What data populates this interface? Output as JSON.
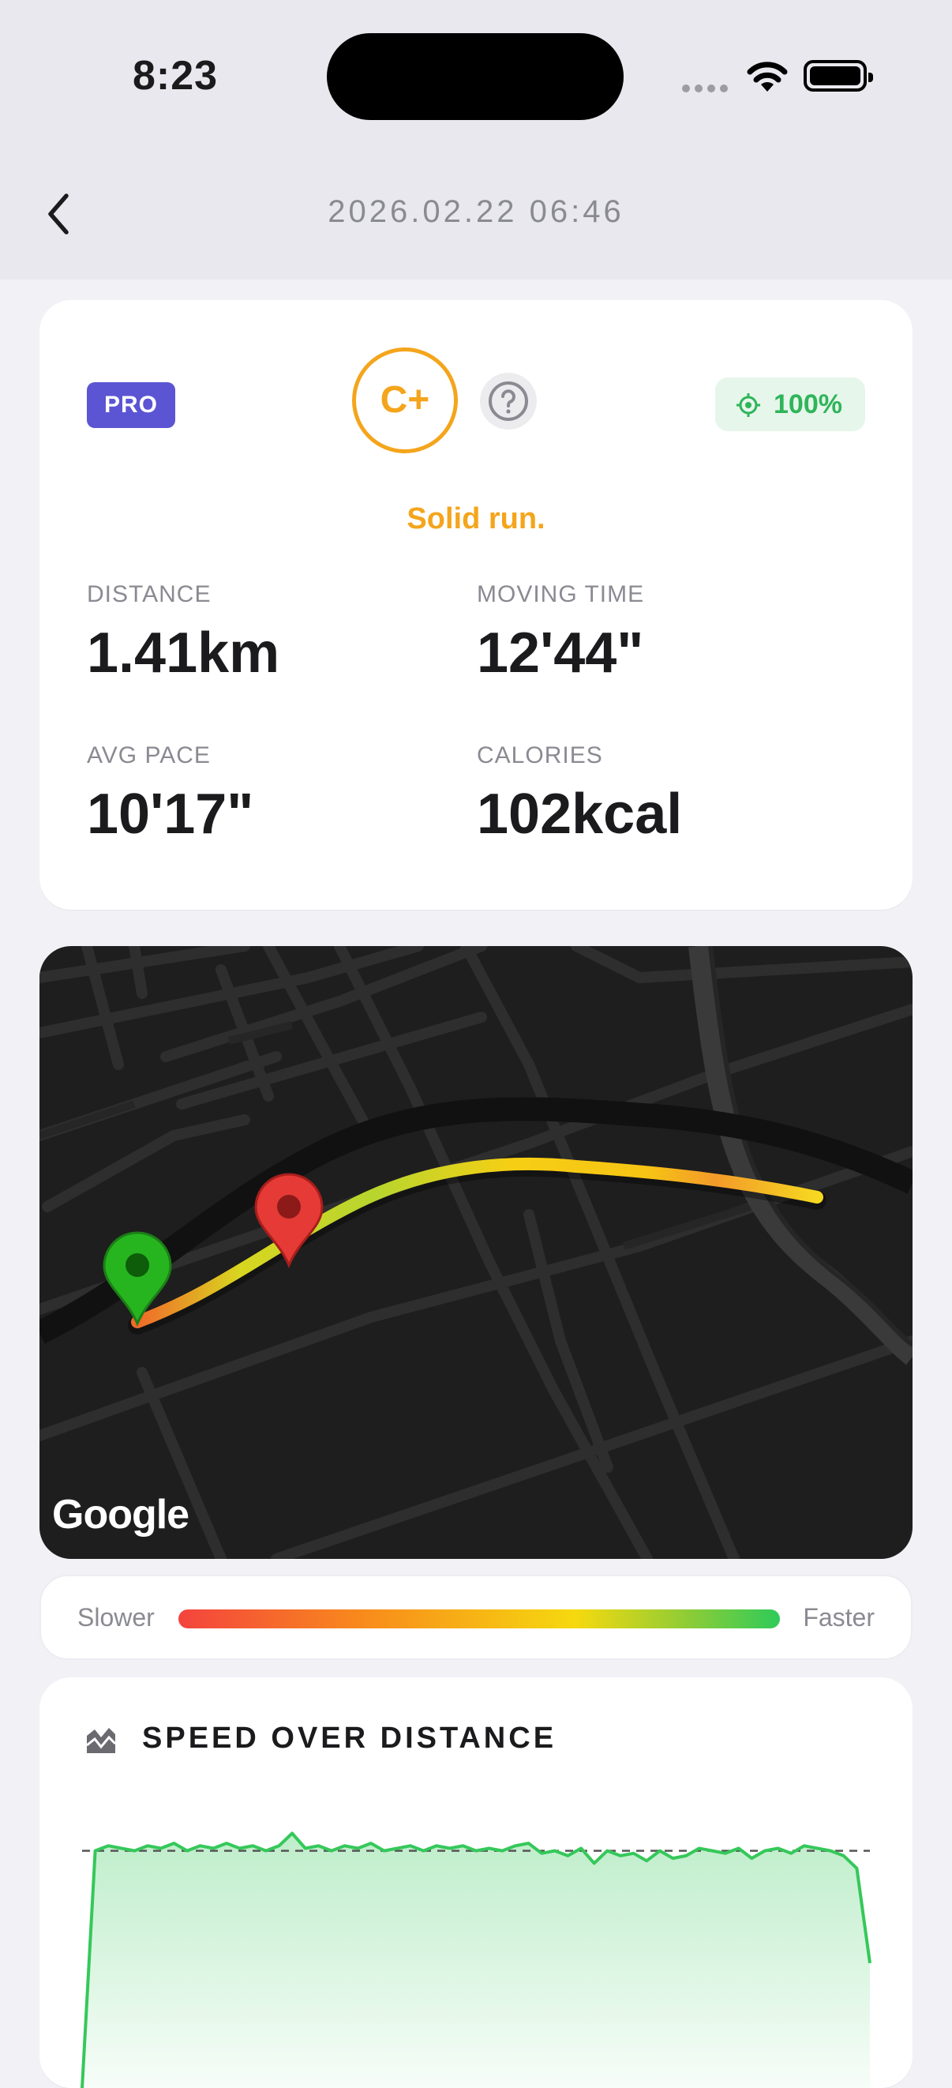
{
  "status": {
    "time": "8:23"
  },
  "nav": {
    "title": "2026.02.22  06:46"
  },
  "summary": {
    "badge": "PRO",
    "grade": "C+",
    "gps": "100%",
    "tagline": "Solid run.",
    "stats": [
      {
        "label": "DISTANCE",
        "value": "1.41km"
      },
      {
        "label": "MOVING TIME",
        "value": "12'44\""
      },
      {
        "label": "AVG PACE",
        "value": "10'17\""
      },
      {
        "label": "CALORIES",
        "value": "102kcal"
      }
    ]
  },
  "map": {
    "attribution": "Google"
  },
  "legend": {
    "slower": "Slower",
    "faster": "Faster"
  },
  "speed_section": {
    "title": "SPEED OVER DISTANCE"
  },
  "colors": {
    "accent": "#f4a51c",
    "pro": "#5b55d3",
    "good": "#2fb45a",
    "line": "#35c85a"
  },
  "chart_data": {
    "type": "area",
    "title": "SPEED OVER DISTANCE",
    "x": [
      0,
      1,
      2,
      3,
      4,
      5,
      6,
      7,
      8,
      9,
      10,
      11,
      12,
      13,
      14,
      15,
      16,
      17,
      18,
      19,
      20,
      21,
      22,
      23,
      24,
      25,
      26,
      27,
      28,
      29,
      30,
      31,
      32,
      33,
      34,
      35,
      36,
      37,
      38,
      39,
      40,
      41,
      42,
      43,
      44,
      45,
      46,
      47,
      48,
      49,
      50,
      51,
      52,
      53,
      54,
      55,
      56,
      57,
      58,
      59,
      60
    ],
    "values": [
      0,
      0.95,
      0.97,
      0.96,
      0.95,
      0.97,
      0.96,
      0.98,
      0.95,
      0.97,
      0.96,
      0.98,
      0.96,
      0.97,
      0.95,
      0.97,
      1.02,
      0.96,
      0.97,
      0.95,
      0.97,
      0.96,
      0.98,
      0.95,
      0.96,
      0.97,
      0.95,
      0.97,
      0.96,
      0.97,
      0.95,
      0.96,
      0.95,
      0.97,
      0.98,
      0.94,
      0.95,
      0.93,
      0.96,
      0.9,
      0.95,
      0.93,
      0.94,
      0.91,
      0.95,
      0.92,
      0.93,
      0.96,
      0.95,
      0.94,
      0.96,
      0.92,
      0.95,
      0.96,
      0.94,
      0.97,
      0.96,
      0.95,
      0.93,
      0.88,
      0.5
    ],
    "reference": 0.95,
    "grid": false
  }
}
